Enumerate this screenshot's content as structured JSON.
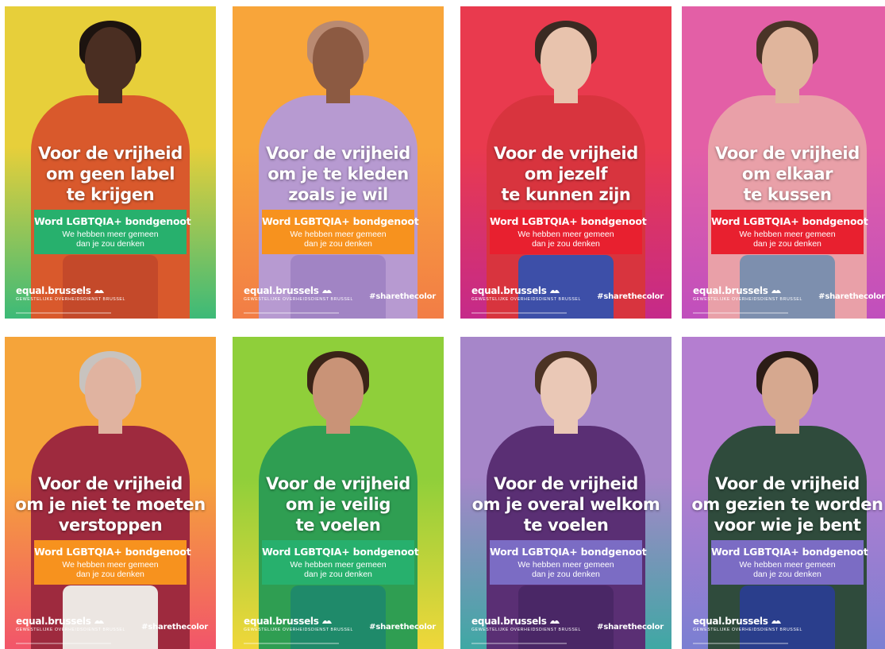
{
  "brand": {
    "name": "equal.brussels",
    "sub": "GEWESTELIJKE OVERHEIDSDIENST BRUSSEL"
  },
  "hashtag": "#sharethecolor",
  "cta": {
    "title": "Word LGBTQIA+ bondgenoot",
    "sub1": "We hebben meer gemeen",
    "sub2": "dan je zou denken"
  },
  "posters": [
    {
      "headline": [
        "Voor de vrijheid",
        "om geen label",
        "te krijgen"
      ],
      "bg_top": "#e7cf3a",
      "bg_bottom": "#3cba78",
      "cta_color": "#27b06d",
      "show_hashtag": false,
      "skin": "#4a2e22",
      "hair": "#1c130f",
      "torso": "#d9592c",
      "legs": "#c4492a"
    },
    {
      "headline": [
        "Voor de vrijheid",
        "om je te kleden",
        "zoals je wil"
      ],
      "bg_top": "#f8a53a",
      "bg_bottom": "#f27d46",
      "cta_color": "#f7921e",
      "show_hashtag": true,
      "skin": "#8c5a42",
      "hair": "#b98a72",
      "torso": "#b79ad1",
      "legs": "#a184c4"
    },
    {
      "headline": [
        "Voor de vrijheid",
        "om jezelf",
        "te kunnen zijn"
      ],
      "bg_top": "#e93a4e",
      "bg_bottom": "#c52a8a",
      "cta_color": "#e8202f",
      "show_hashtag": true,
      "skin": "#e8c3ad",
      "hair": "#3a2a22",
      "torso": "#d8343e",
      "legs": "#3d4fa8"
    },
    {
      "headline": [
        "Voor de vrijheid",
        "om elkaar",
        "te kussen"
      ],
      "bg_top": "#e35fa6",
      "bg_bottom": "#c04fbd",
      "cta_color": "#e8202f",
      "show_hashtag": true,
      "skin": "#e0b59c",
      "hair": "#4a3427",
      "torso": "#e9a0a8",
      "legs": "#7d8fae"
    },
    {
      "headline": [
        "Voor de vrijheid",
        "om je niet te moeten",
        "verstoppen"
      ],
      "bg_top": "#f5a43a",
      "bg_bottom": "#f2556a",
      "cta_color": "#f7921e",
      "show_hashtag": true,
      "skin": "#e0b3a0",
      "hair": "#c8c3bf",
      "torso": "#9e2a3e",
      "legs": "#ece6e2"
    },
    {
      "headline": [
        "Voor de vrijheid",
        "om je veilig",
        "te voelen"
      ],
      "bg_top": "#8fcf3a",
      "bg_bottom": "#f0d73a",
      "cta_color": "#27b06d",
      "show_hashtag": true,
      "skin": "#c99377",
      "hair": "#3b2418",
      "torso": "#2f9e52",
      "legs": "#1f8a6a"
    },
    {
      "headline": [
        "Voor de vrijheid",
        "om je overal welkom",
        "te voelen"
      ],
      "bg_top": "#a686c9",
      "bg_bottom": "#3fa8a4",
      "cta_color": "#7b6cc4",
      "show_hashtag": true,
      "skin": "#eac8b6",
      "hair": "#4c3324",
      "torso": "#5a2f74",
      "legs": "#4a2766"
    },
    {
      "headline": [
        "Voor de vrijheid",
        "om gezien te worden",
        "voor wie je bent"
      ],
      "bg_top": "#b47ed0",
      "bg_bottom": "#7a7fd2",
      "cta_color": "#7b6cc4",
      "show_hashtag": false,
      "skin": "#d6a88f",
      "hair": "#2b1c16",
      "torso": "#2f4b3c",
      "legs": "#2a3e8c"
    }
  ]
}
